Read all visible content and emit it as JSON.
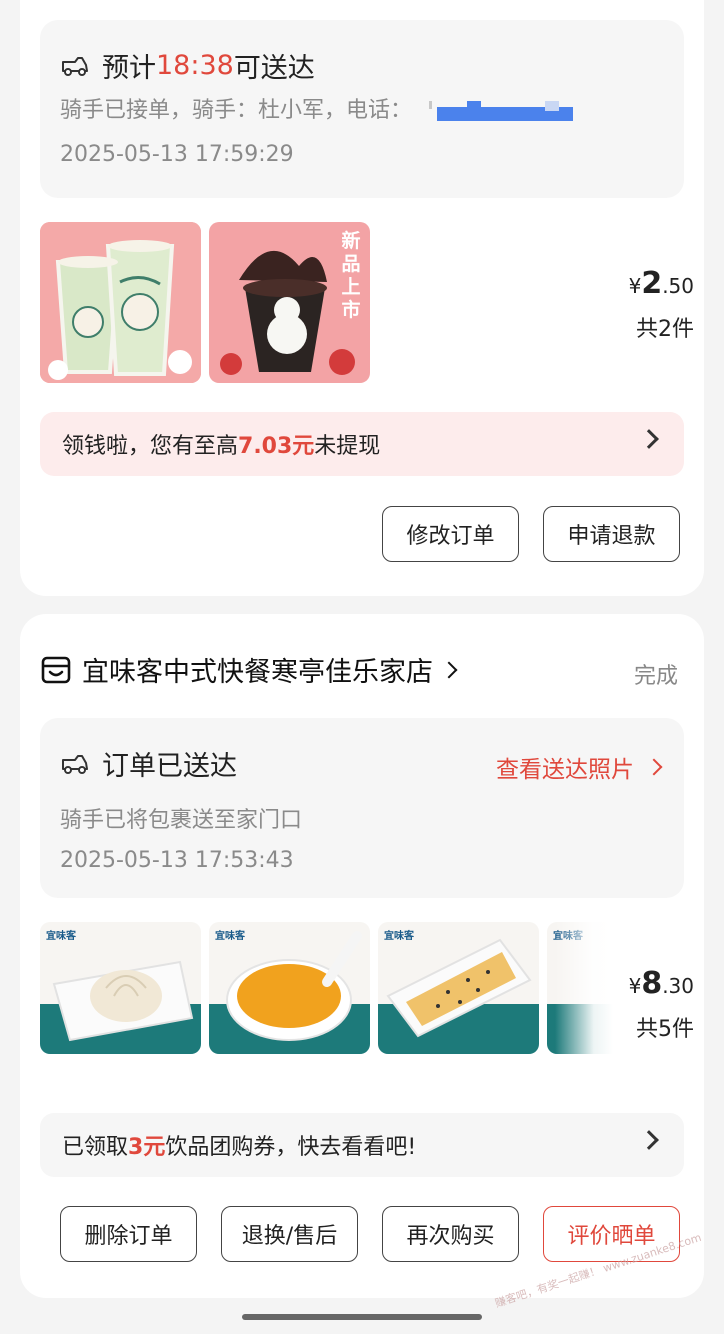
{
  "order1": {
    "eta_prefix": "预计",
    "eta_time": "18:38",
    "eta_suffix": "可送达",
    "rider_text": "骑手已接单，骑手：杜小军，电话：",
    "timestamp": "2025-05-13 17:59:29",
    "products": [
      {
        "name": "drink-cups"
      },
      {
        "name": "chocolate-sundae",
        "tag": "新品上市"
      }
    ],
    "price_yen": "¥",
    "price_int": "2",
    "price_dec": ".50",
    "count": "共2件",
    "promo_prefix": "领钱啦，您有至高",
    "promo_amount": "7.03元",
    "promo_suffix": "未提现",
    "buttons": {
      "modify": "修改订单",
      "refund": "申请退款"
    }
  },
  "order2": {
    "shop_name": "宜味客中式快餐寒亭佳乐家店",
    "status_label": "完成",
    "delivered_title": "订单已送达",
    "photo_link": "查看送达照片",
    "delivered_desc": "骑手已将包裹送至家门口",
    "timestamp": "2025-05-13 17:53:43",
    "products": [
      {
        "name": "xiaolongbao"
      },
      {
        "name": "corn-soup"
      },
      {
        "name": "scallion-pancake"
      },
      {
        "name": "food-item-4"
      }
    ],
    "price_yen": "¥",
    "price_int": "8",
    "price_dec": ".30",
    "count": "共5件",
    "promo_prefix": "已领取",
    "promo_amount": "3元",
    "promo_suffix": "饮品团购券，快去看看吧!",
    "buttons": {
      "delete": "删除订单",
      "after_sale": "退换/售后",
      "rebuy": "再次购买",
      "review": "评价晒单"
    }
  },
  "colors": {
    "accent": "#e0483c",
    "promo_bg": "#fdeceb",
    "teal": "#1d7a7a",
    "mask_blue": "#4b82ec"
  },
  "watermark": "赚客吧，有奖一起赚！ www.zuanke8.com"
}
